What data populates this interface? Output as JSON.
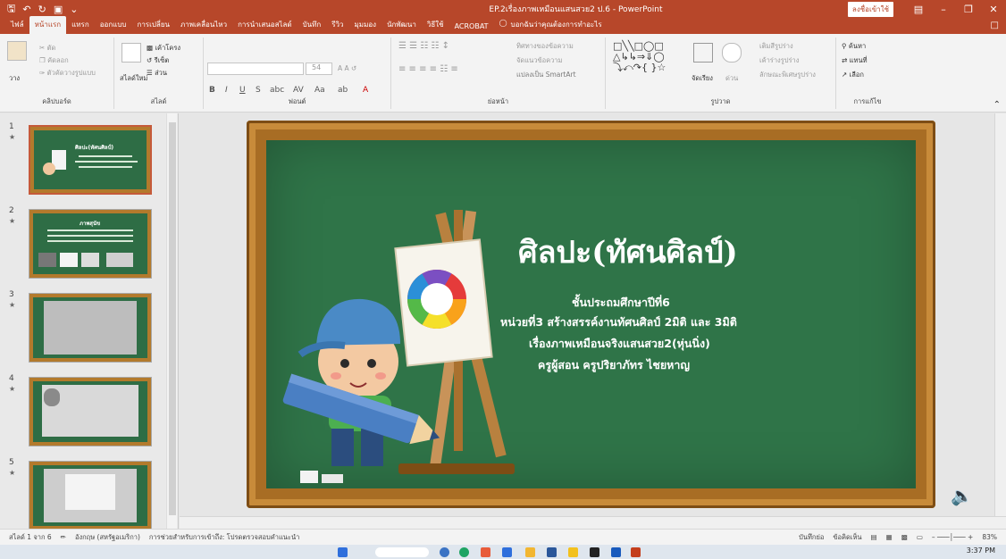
{
  "window": {
    "title": "EP.2เรื่องภาพเหมือนแสนสวย2 ป.6 - PowerPoint",
    "sign_in": "ลงชื่อเข้าใช้"
  },
  "tabs": [
    {
      "label": "ไฟล์"
    },
    {
      "label": "หน้าแรก"
    },
    {
      "label": "แทรก"
    },
    {
      "label": "ออกแบบ"
    },
    {
      "label": "การเปลี่ยน"
    },
    {
      "label": "ภาพเคลื่อนไหว"
    },
    {
      "label": "การนำเสนอสไลด์"
    },
    {
      "label": "บันทึก"
    },
    {
      "label": "รีวิว"
    },
    {
      "label": "มุมมอง"
    },
    {
      "label": "นักพัฒนา"
    },
    {
      "label": "วิธีใช้"
    },
    {
      "label": "ACROBAT"
    }
  ],
  "tell_me": "บอกฉันว่าคุณต้องการทำอะไร",
  "ribbon": {
    "clipboard": {
      "label": "คลิปบอร์ด",
      "paste": "วาง",
      "cut": "ตัด",
      "copy": "คัดลอก",
      "painter": "ตัวคัดวางรูปแบบ"
    },
    "slides": {
      "label": "สไลด์",
      "new": "สไลด์ใหม่",
      "layout": "เค้าโครง",
      "reset": "รีเซ็ต",
      "section": "ส่วน"
    },
    "font": {
      "label": "ฟอนต์",
      "size": "54"
    },
    "paragraph": {
      "label": "ย่อหน้า",
      "direction": "ทิศทางของข้อความ",
      "align": "จัดแนวข้อความ",
      "smartart": "แปลงเป็น SmartArt"
    },
    "drawing": {
      "label": "รูปวาด",
      "arrange": "จัดเรียง",
      "styles": "ด่วน",
      "fill": "เติมสีรูปร่าง",
      "outline": "เค้าร่างรูปร่าง",
      "effects": "ลักษณะพิเศษรูปร่าง"
    },
    "editing": {
      "label": "การแก้ไข",
      "find": "ค้นหา",
      "replace": "แทนที่",
      "select": "เลือก"
    }
  },
  "thumbnails": [
    {
      "num": "1",
      "title": "ศิลปะ(ทัศนศิลป์)"
    },
    {
      "num": "2",
      "title": "ภาพสุนัข"
    },
    {
      "num": "3",
      "title": ""
    },
    {
      "num": "4",
      "title": ""
    },
    {
      "num": "5",
      "title": ""
    }
  ],
  "slide": {
    "title": "ศิลปะ(ทัศนศิลป์)",
    "lines": [
      "ชั้นประถมศึกษาปีที่6",
      "หน่วยที่3 สร้างสรรค์งานทัศนศิลป์ 2มิติ และ 3มิติ",
      "เรื่องภาพเหมือนจริงแสนสวย2(หุ่นนิ่ง)",
      "ครูผู้สอน ครูปริยาภัทร ไชยหาญ"
    ]
  },
  "status": {
    "slide_of": "สไลด์ 1 จาก 6",
    "language": "อังกฤษ (สหรัฐอเมริกา)",
    "accessibility": "การช่วยสำหรับการเข้าถึง: โปรดตรวจสอบคำแนะนำ",
    "notes": "บันทึกย่อ",
    "comments": "ข้อคิดเห็น",
    "zoom": "83%"
  },
  "taskbar": {
    "time": "3:37 PM"
  },
  "colors": {
    "accent": "#b7472a",
    "board": "#2f7448",
    "frame": "#a86d24"
  }
}
